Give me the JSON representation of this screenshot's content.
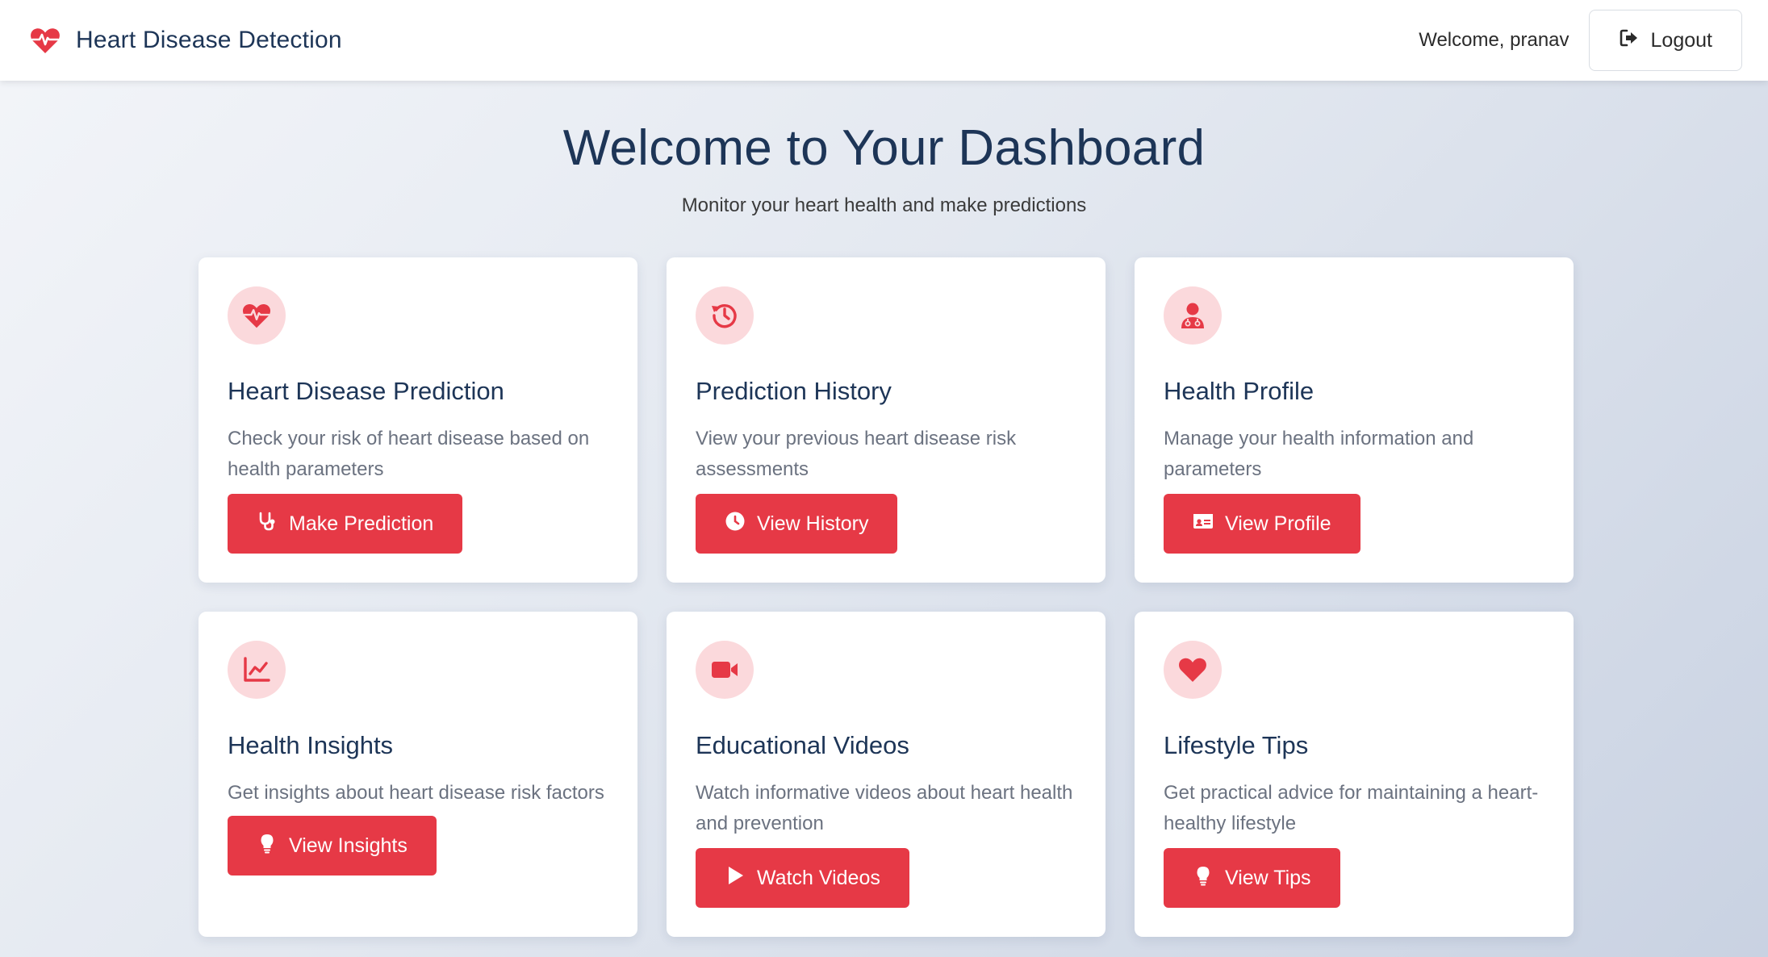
{
  "navbar": {
    "brand_title": "Heart Disease Detection",
    "brand_icon": "heart-pulse-icon",
    "welcome_text": "Welcome, pranav",
    "logout_label": "Logout",
    "logout_icon": "sign-out-icon"
  },
  "header": {
    "title": "Welcome to Your Dashboard",
    "subtitle": "Monitor your heart health and make predictions"
  },
  "cards": [
    {
      "title": "Heart Disease Prediction",
      "description": "Check your risk of heart disease based on health parameters",
      "icon": "heart-pulse-icon",
      "button_label": "Make Prediction",
      "button_icon": "stethoscope-icon"
    },
    {
      "title": "Prediction History",
      "description": "View your previous heart disease risk assessments",
      "icon": "history-icon",
      "button_label": "View History",
      "button_icon": "clock-icon"
    },
    {
      "title": "Health Profile",
      "description": "Manage your health information and parameters",
      "icon": "user-doctor-icon",
      "button_label": "View Profile",
      "button_icon": "id-card-icon"
    },
    {
      "title": "Health Insights",
      "description": "Get insights about heart disease risk factors",
      "icon": "chart-line-icon",
      "button_label": "View Insights",
      "button_icon": "lightbulb-icon"
    },
    {
      "title": "Educational Videos",
      "description": "Watch informative videos about heart health and prevention",
      "icon": "video-icon",
      "button_label": "Watch Videos",
      "button_icon": "play-icon"
    },
    {
      "title": "Lifestyle Tips",
      "description": "Get practical advice for maintaining a heart-healthy lifestyle",
      "icon": "heart-icon",
      "button_label": "View Tips",
      "button_icon": "lightbulb-icon"
    }
  ],
  "colors": {
    "accent": "#e63946",
    "icon_bg": "#fbd9dc",
    "title_text": "#1d3557",
    "desc_text": "#6b7280"
  }
}
